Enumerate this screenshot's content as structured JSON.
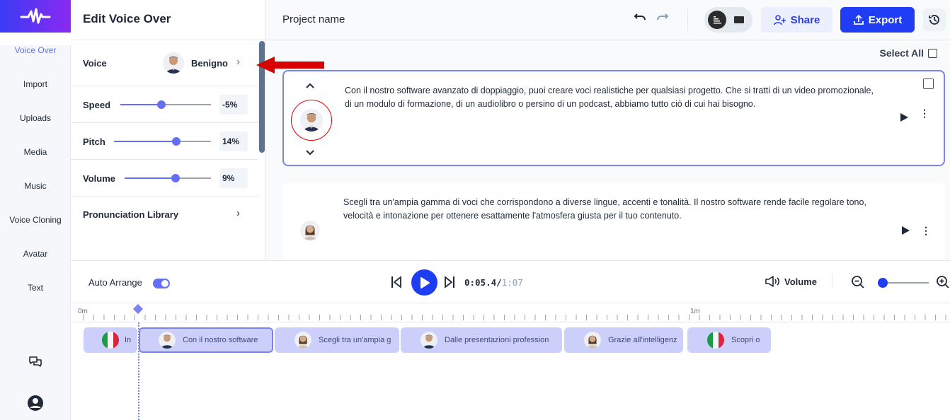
{
  "sidebar": {
    "items": [
      {
        "label": "Voice Over",
        "active": true
      },
      {
        "label": "Import"
      },
      {
        "label": "Uploads"
      },
      {
        "label": "Media"
      },
      {
        "label": "Music"
      },
      {
        "label": "Voice Cloning"
      },
      {
        "label": "Avatar"
      },
      {
        "label": "Text"
      }
    ],
    "bottom_icons": [
      "chat-icon",
      "profile-icon"
    ]
  },
  "panel": {
    "title": "Edit Voice Over",
    "voice": {
      "label": "Voice",
      "name": "Benigno"
    },
    "speed": {
      "label": "Speed",
      "value": "-5%",
      "fraction": 0.45
    },
    "pitch": {
      "label": "Pitch",
      "value": "14%",
      "fraction": 0.64
    },
    "volume": {
      "label": "Volume",
      "value": "9%",
      "fraction": 0.59
    },
    "pronunciation": {
      "label": "Pronunciation Library"
    }
  },
  "header": {
    "project_name": "Project name",
    "share_label": "Share",
    "export_label": "Export"
  },
  "main": {
    "select_all_label": "Select All",
    "cards": [
      {
        "text": "Con il nostro software avanzato di doppiaggio, puoi creare voci realistiche per qualsiasi progetto. Che si tratti di un video promozionale, di un modulo di formazione, di un audiolibro o persino di un podcast, abbiamo tutto ciò di cui hai bisogno.",
        "voice": "male",
        "selected": true
      },
      {
        "text": "Scegli tra un'ampia gamma di voci che corrispondono a diverse lingue, accenti e tonalità. Il nostro software rende facile regolare tono, velocità e intonazione per ottenere esattamente l'atmosfera giusta per il tuo contenuto.",
        "voice": "female",
        "selected": false
      }
    ]
  },
  "player": {
    "auto_arrange_label": "Auto Arrange",
    "auto_arrange_on": true,
    "current_time": "0:05.4",
    "separator": "/",
    "total_time": "1:07",
    "volume_label": "Volume",
    "zoom_fraction": 0.0
  },
  "ruler": {
    "labels": [
      "0m",
      "1m"
    ]
  },
  "clips": [
    {
      "text": "In",
      "type": "flag"
    },
    {
      "text": "Con il nostro software",
      "type": "male",
      "selected": true
    },
    {
      "text": "Scegli tra un'ampia g",
      "type": "female"
    },
    {
      "text": "Dalle presentazioni profession",
      "type": "male"
    },
    {
      "text": "Grazie all'intelligenz",
      "type": "female"
    },
    {
      "text": "Scopri o",
      "type": "flag"
    }
  ],
  "colors": {
    "accent": "#6470f3",
    "export": "#1f3df5",
    "clip": "#cdcffb",
    "annotation": "#d90000"
  }
}
